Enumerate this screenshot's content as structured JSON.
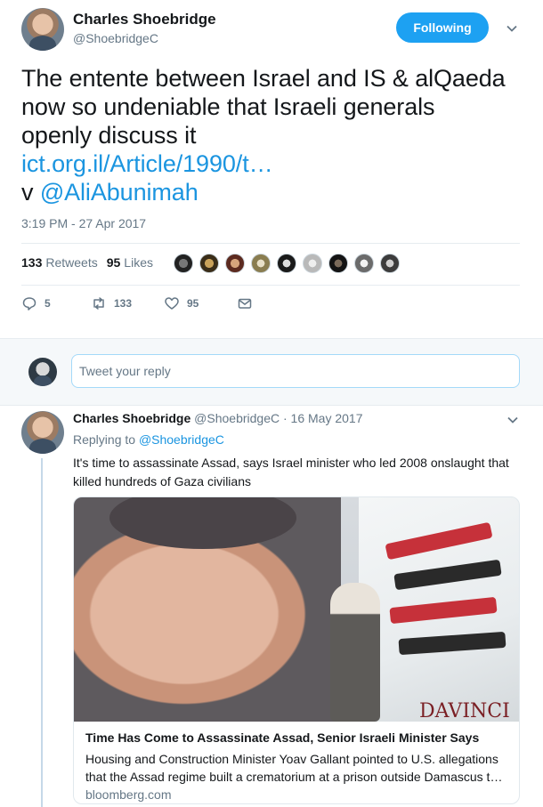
{
  "tweet": {
    "author_name": "Charles Shoebridge",
    "author_handle": "@ShoebridgeC",
    "follow_label": "Following",
    "text_line1": "The entente between Israel and IS & alQaeda",
    "text_line2": "now so undeniable that Israeli generals",
    "text_line3": "openly discuss it",
    "link_text": "ict.org.il/Article/1990/t…",
    "via_prefix": "v ",
    "via_handle": "@AliAbunimah",
    "timestamp": "3:19 PM - 27 Apr 2017",
    "retweets_count": "133",
    "retweets_label": "Retweets",
    "likes_count": "95",
    "likes_label": "Likes",
    "reply_count": "5",
    "retweet_action_count": "133",
    "like_action_count": "95"
  },
  "reply_box": {
    "placeholder": "Tweet your reply"
  },
  "reply_tweet": {
    "author_name": "Charles Shoebridge",
    "author_handle": "@ShoebridgeC",
    "separator": " · ",
    "date": "16 May 2017",
    "replying_prefix": "Replying to ",
    "replying_handle": "@ShoebridgeC",
    "text": "It's time to assassinate Assad, says Israel minister who led 2008 onslaught that killed hundreds of Gaza civilians",
    "card": {
      "title": "Time Has Come to Assassinate Assad, Senior Israeli Minister Says",
      "description_line1": "Housing and Construction Minister Yoav Gallant pointed to U.S. allegations",
      "description_line2": "that the Assad regime built a crematorium at a prison outside Damascus t…",
      "domain": "bloomberg.com",
      "image_sign_text": "DAVINCI"
    }
  },
  "colors": {
    "accent": "#1da1f2",
    "link": "#1b95e0",
    "muted": "#657786"
  },
  "icons": {
    "reply": "speech-bubble-icon",
    "retweet": "retweet-icon",
    "like": "heart-icon",
    "message": "envelope-icon",
    "menu": "chevron-down-icon"
  }
}
